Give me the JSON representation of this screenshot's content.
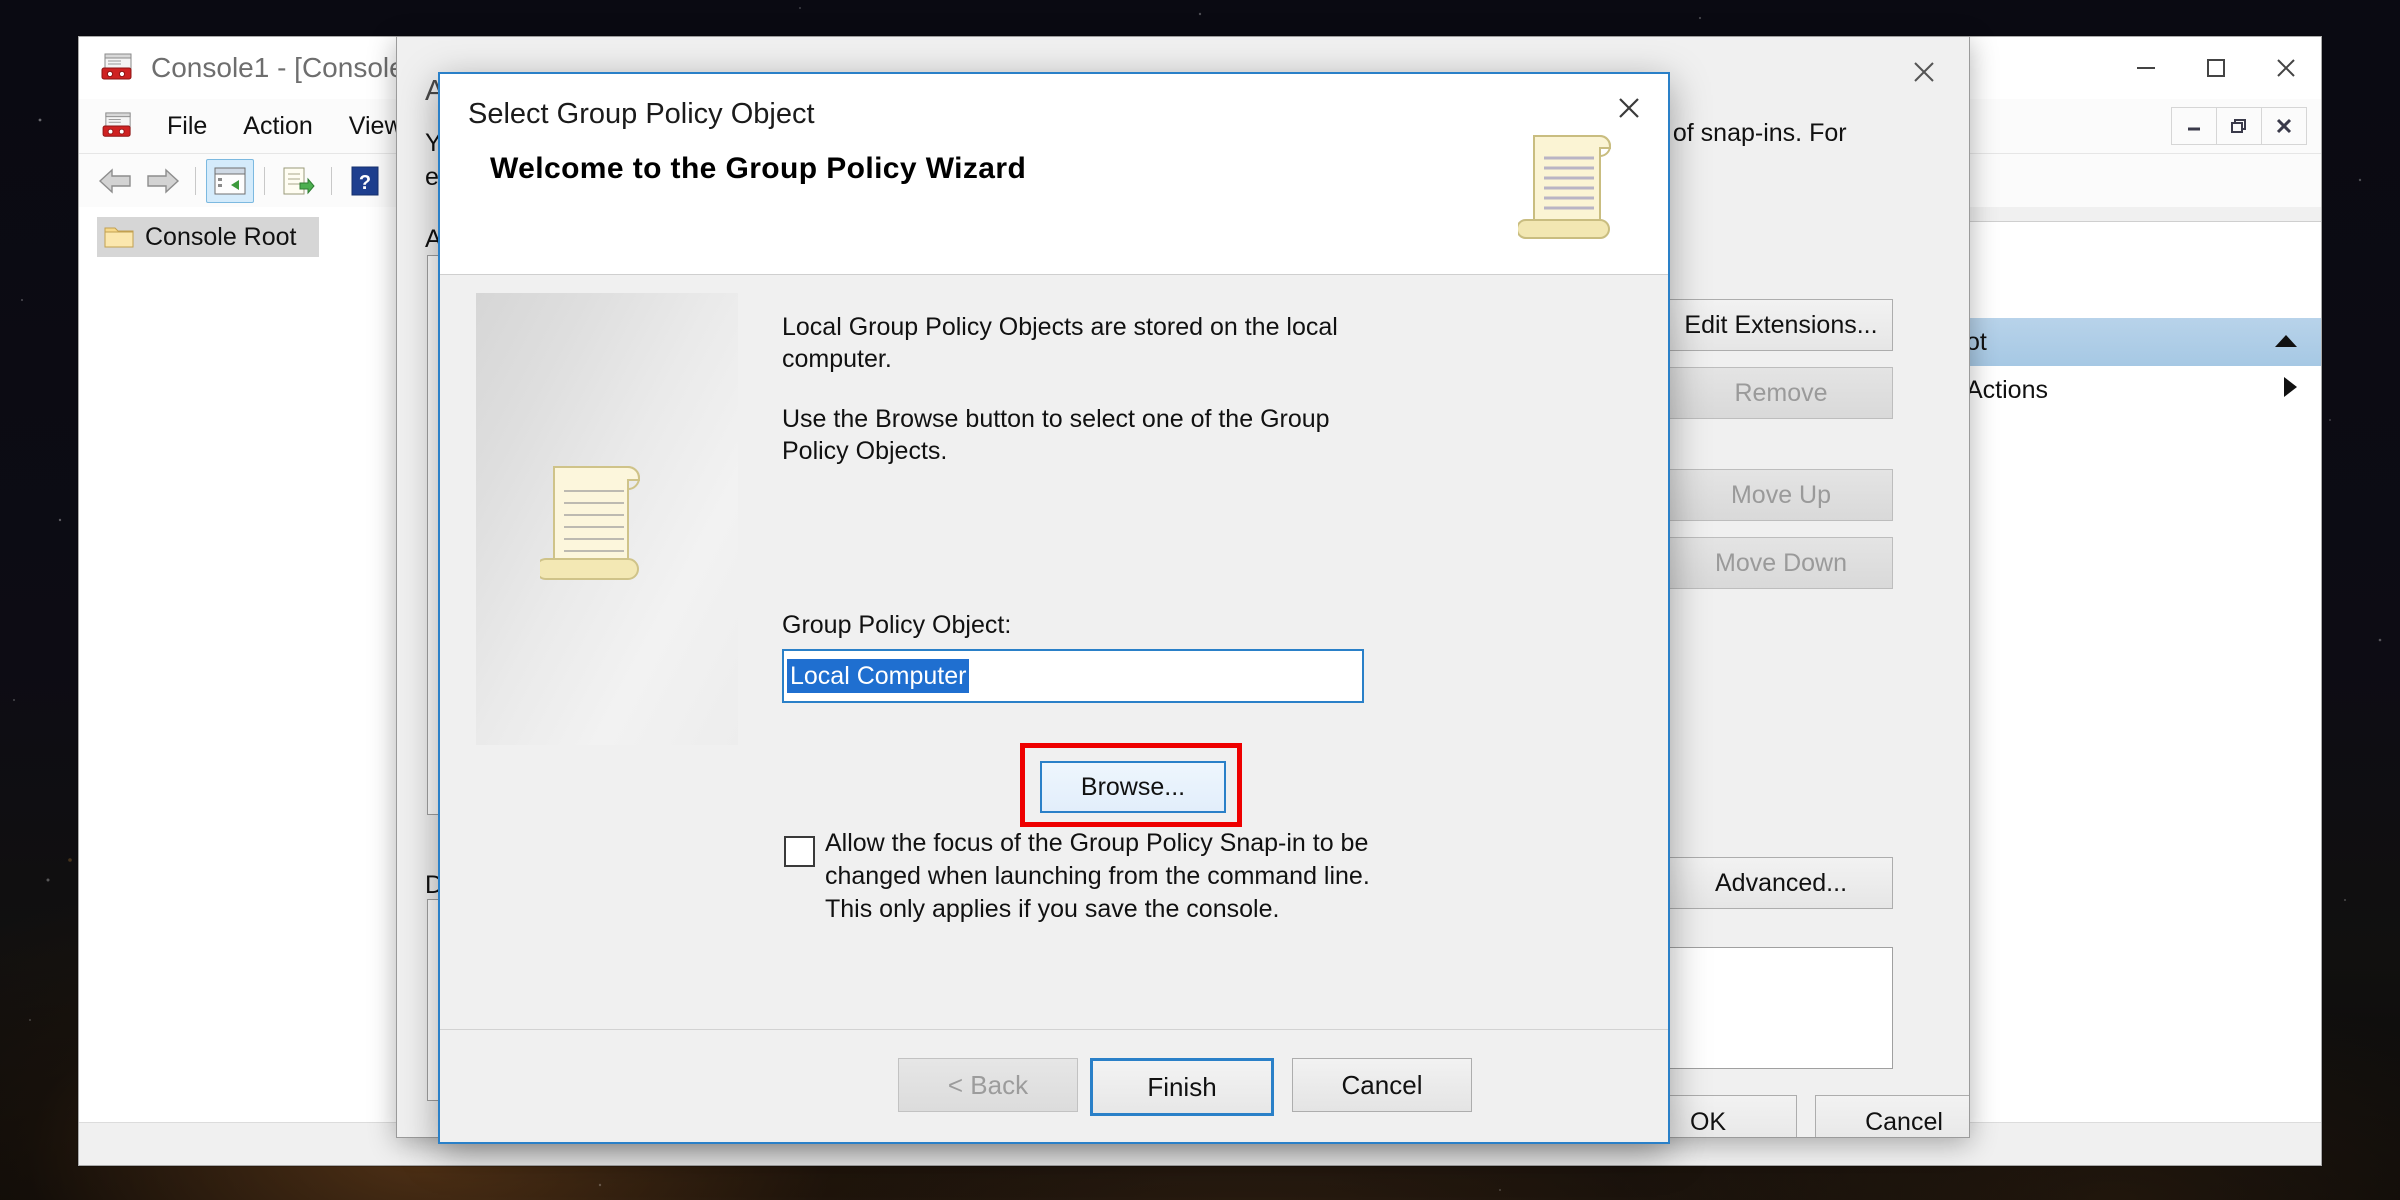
{
  "desktop": {
    "wallpaper_name": "night-sky-wallpaper"
  },
  "mmc_window": {
    "title": "Console1 - [Console",
    "title_icon": "mmc-console-icon",
    "window_controls": {
      "minimize": "minimize-icon",
      "maximize": "maximize-icon",
      "close": "close-icon"
    },
    "mdi_controls": {
      "minimize": "mdi-minimize-icon",
      "restore": "mdi-restore-icon",
      "close": "mdi-close-icon"
    },
    "menu": {
      "icon": "mmc-console-icon",
      "items": [
        {
          "label": "File"
        },
        {
          "label": "Action"
        },
        {
          "label": "View"
        }
      ]
    },
    "toolbar": {
      "items": [
        {
          "name": "back-arrow-icon"
        },
        {
          "name": "forward-arrow-icon"
        },
        {
          "name": "show-hide-console-tree-icon"
        },
        {
          "name": "export-list-icon"
        },
        {
          "name": "help-icon"
        }
      ]
    },
    "tree": {
      "root_label": "Console Root",
      "root_icon": "folder-icon"
    },
    "actions_pane": {
      "rows": [
        {
          "label": "ot",
          "glyph": "collapse-up-arrow",
          "selected": true
        },
        {
          "label": "Actions",
          "glyph": "submenu-right-arrow",
          "selected": false
        }
      ]
    }
  },
  "snapins_dialog": {
    "title": "Add or Remove Snap-ins",
    "close_icon": "close-icon",
    "body_text_fragments": [
      {
        "text": "Y"
      },
      {
        "text": "e"
      },
      {
        "text": "A"
      },
      {
        "text": "D"
      }
    ],
    "right_text": "t of snap-ins. For",
    "buttons": [
      {
        "label": "Edit Extensions...",
        "accesskey": "x",
        "disabled": false
      },
      {
        "label": "Remove",
        "accesskey": "R",
        "disabled": true
      },
      {
        "label": "Move Up",
        "accesskey": "U",
        "disabled": true
      },
      {
        "label": "Move Down",
        "accesskey": "D",
        "disabled": true
      },
      {
        "label": "Advanced...",
        "accesskey": "v",
        "disabled": false
      }
    ],
    "footer_buttons": [
      {
        "label": "OK"
      },
      {
        "label": "Cancel"
      }
    ]
  },
  "gpo_wizard": {
    "caption": "Select Group Policy Object",
    "close_icon": "close-icon",
    "welcome_heading": "Welcome to the Group Policy Wizard",
    "header_icon": "scroll-document-icon",
    "graphic_icon": "scroll-document-icon",
    "paragraph1": "Local Group Policy Objects are stored on the local computer.",
    "paragraph2": "Use the Browse button to select one of the Group Policy Objects.",
    "field_label": "Group Policy Object:",
    "field_value": "Local Computer",
    "browse_button": "Browse...",
    "browse_highlight_color": "#ee0000",
    "checkbox": {
      "checked": false,
      "label": "Allow the focus of the Group Policy Snap-in to be changed when launching from the command line.  This only applies if you save the console."
    },
    "footer_buttons": [
      {
        "label": "< Back",
        "state": "disabled"
      },
      {
        "label": "Finish",
        "state": "default"
      },
      {
        "label": "Cancel",
        "state": "normal"
      }
    ]
  },
  "colors": {
    "accent_blue": "#2a80c8",
    "selection_blue": "#1f6fd0",
    "highlight_red": "#ee0000",
    "dialog_bg": "#f0f0f0"
  }
}
